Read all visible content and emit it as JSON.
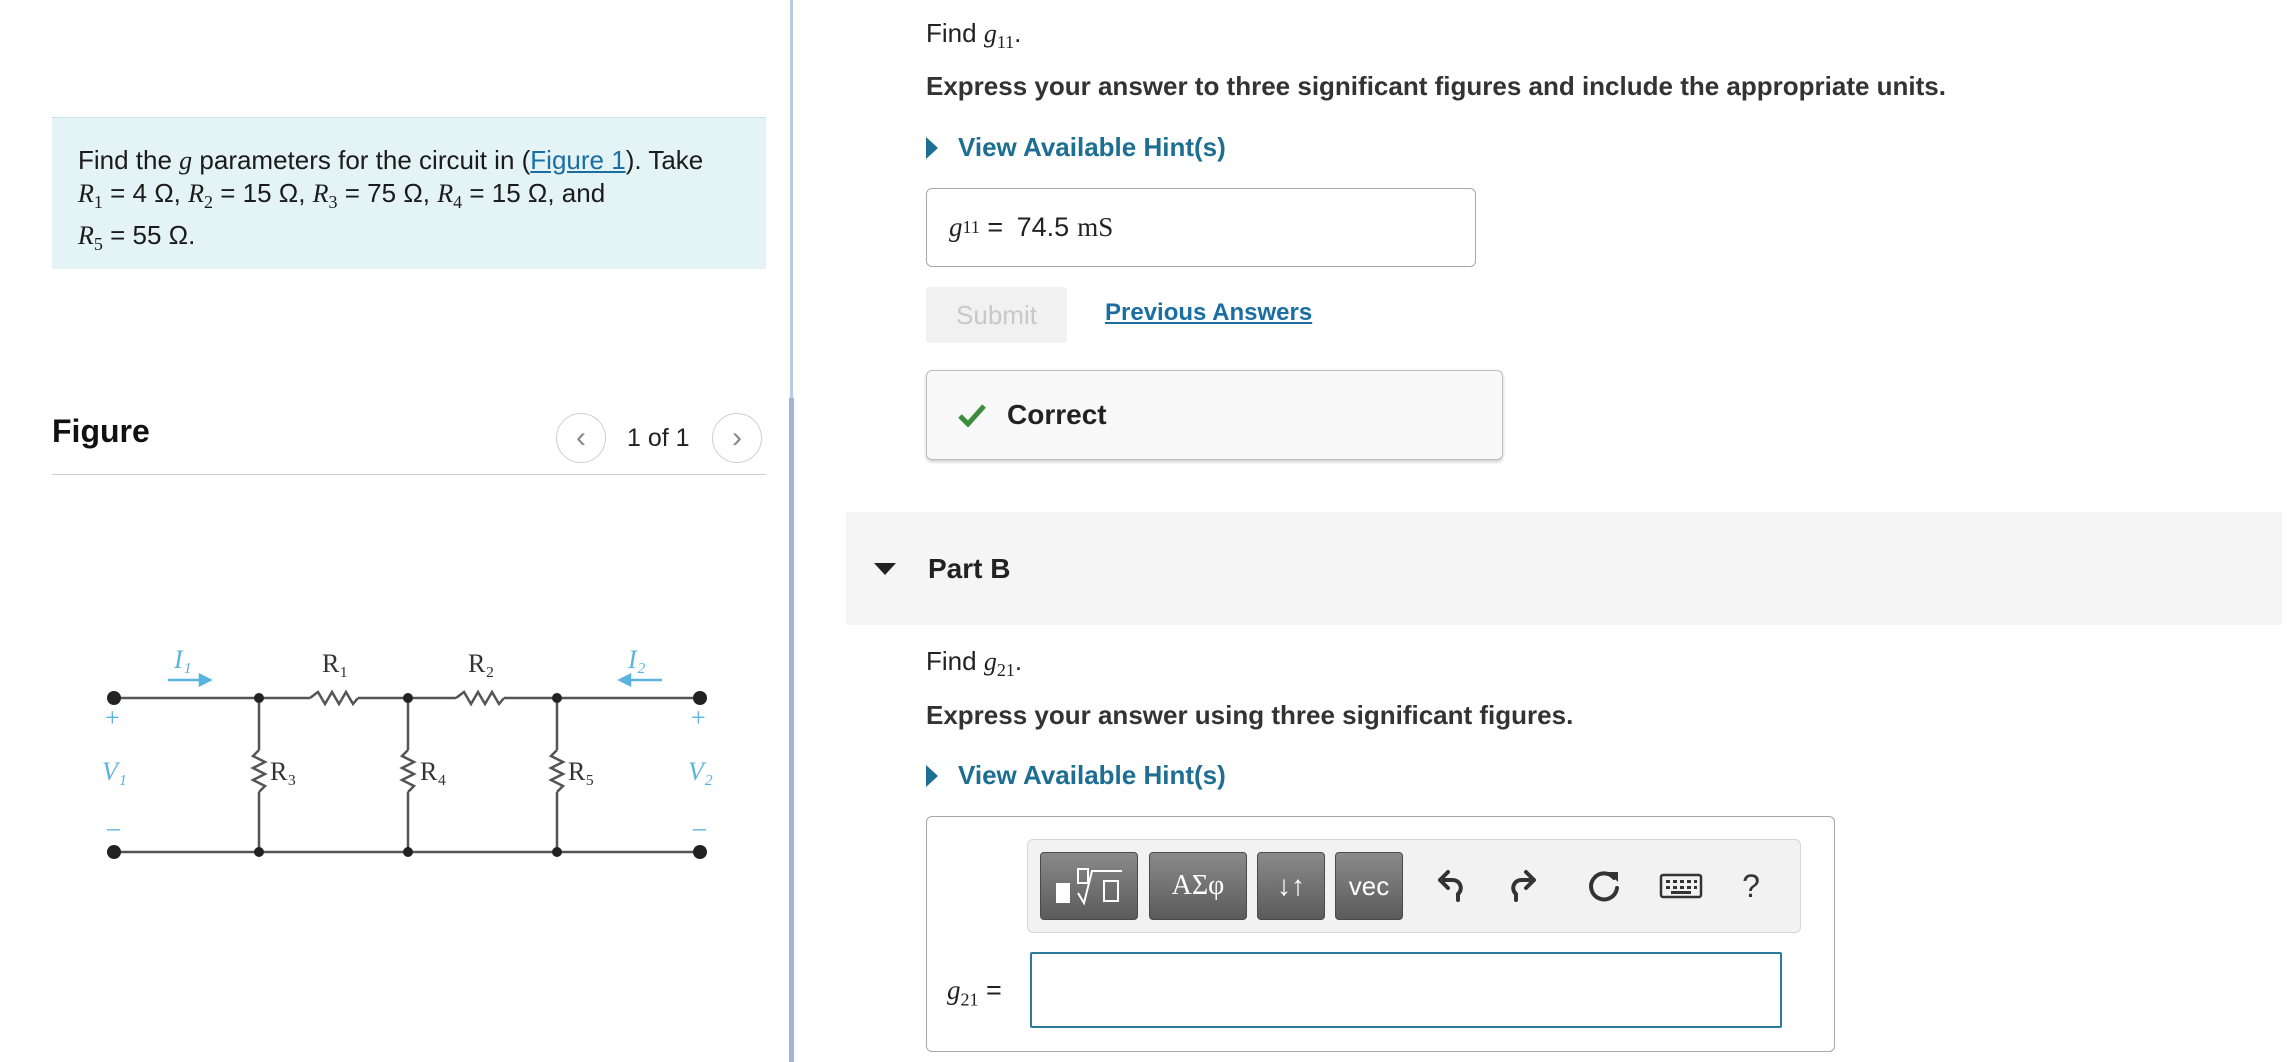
{
  "problem": {
    "intro": "Find the ",
    "g_symbol": "g",
    "mid": " parameters for the circuit in (",
    "figure_link": "Figure 1",
    "after_link": "). Take",
    "r1": "R",
    "r1_sub": "1",
    "r1_val": " = 4 Ω, ",
    "r2": "R",
    "r2_sub": "2",
    "r2_val": " = 15 Ω, ",
    "r3": "R",
    "r3_sub": "3",
    "r3_val": " = 75 Ω, ",
    "r4": "R",
    "r4_sub": "4",
    "r4_val": " = 15 Ω, and",
    "r5": "R",
    "r5_sub": "5",
    "r5_val": " = 55 Ω."
  },
  "figure": {
    "title": "Figure",
    "counter": "1 of 1",
    "prev_glyph": "‹",
    "next_glyph": "›",
    "labels": {
      "i1": "I₁",
      "i2": "I₂",
      "r1": "R₁",
      "r2": "R₂",
      "r3": "R₃",
      "r4": "R₄",
      "r5": "R₅",
      "v1": "V₁",
      "v2": "V₂",
      "plus": "+",
      "minus": "–"
    }
  },
  "part_a": {
    "find_prefix": "Find ",
    "var": "g",
    "var_sub": "11",
    "find_suffix": ".",
    "instruction": "Express your answer to three significant figures and include the appropriate units.",
    "hint": "View Available Hint(s)",
    "answer_label": "g",
    "answer_label_sub": "11",
    "answer_eq": " = ",
    "answer_value": "74.5",
    "answer_unit": "mS",
    "submit": "Submit",
    "previous_answers": "Previous Answers",
    "feedback": "Correct"
  },
  "part_b": {
    "header": "Part B",
    "find_prefix": "Find ",
    "var": "g",
    "var_sub": "21",
    "find_suffix": ".",
    "instruction": "Express your answer using three significant figures.",
    "hint": "View Available Hint(s)",
    "toolbar": {
      "greek": "ΑΣφ",
      "arrows": "↓↑",
      "vec": "vec",
      "help": "?"
    },
    "answer_label": "g",
    "answer_label_sub": "21",
    "answer_eq": " =",
    "answer_value": ""
  },
  "colors": {
    "accent": "#1d6e93",
    "problem_bg": "#e4f3f5",
    "correct_check": "#3d8b3d",
    "circuit_blue": "#5ab3df"
  }
}
